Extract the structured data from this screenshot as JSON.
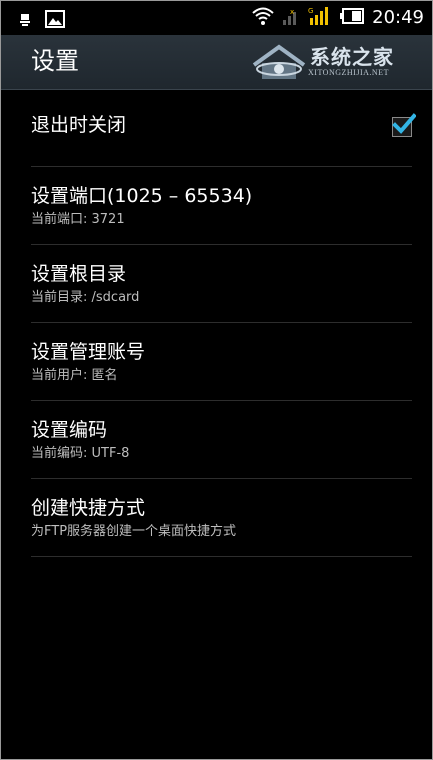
{
  "status_bar": {
    "left_icons": [
      "usb-debug-icon",
      "image-notification-icon"
    ],
    "right_icons": [
      "wifi-icon",
      "signal-icon",
      "signal-dual-icon",
      "battery-icon"
    ],
    "time": "20:49",
    "accent_color": "#f2c100"
  },
  "action_bar": {
    "title": "设置",
    "watermark_main": "系统之家",
    "watermark_sub": "XITONGZHIJIA.NET"
  },
  "settings": [
    {
      "title": "退出时关闭",
      "summary": "",
      "checked": true
    },
    {
      "title": "设置端口(1025 – 65534)",
      "summary": "当前端口: 3721"
    },
    {
      "title": "设置根目录",
      "summary": "当前目录: /sdcard"
    },
    {
      "title": "设置管理账号",
      "summary": "当前用户: 匿名"
    },
    {
      "title": "设置编码",
      "summary": "当前编码: UTF-8"
    },
    {
      "title": "创建快捷方式",
      "summary": "为FTP服务器创建一个桌面快捷方式"
    }
  ],
  "colors": {
    "background": "#000000",
    "action_bar": "#252e35",
    "checkbox_check": "#33b5e5",
    "divider": "#2d2d2d",
    "summary_text": "#bdbdbd"
  }
}
